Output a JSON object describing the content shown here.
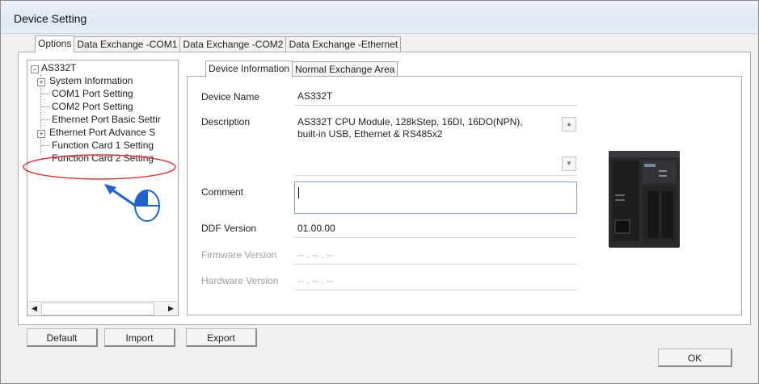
{
  "window": {
    "title": "Device Setting"
  },
  "top_tabs": [
    {
      "label": "Options"
    },
    {
      "label": "Data Exchange -COM1"
    },
    {
      "label": "Data Exchange -COM2"
    },
    {
      "label": "Data Exchange -Ethernet"
    }
  ],
  "tree": {
    "root": "AS332T",
    "items": [
      {
        "label": "System Information"
      },
      {
        "label": "COM1 Port Setting"
      },
      {
        "label": "COM2 Port Setting"
      },
      {
        "label": "Ethernet Port Basic Settir"
      },
      {
        "label": "Ethernet Port Advance S"
      },
      {
        "label": "Function Card 1 Setting"
      },
      {
        "label": "Function Card 2 Setting"
      }
    ]
  },
  "inner_tabs": [
    {
      "label": "Device Information"
    },
    {
      "label": "Normal Exchange Area"
    }
  ],
  "device_info": {
    "device_name_label": "Device Name",
    "device_name_value": "AS332T",
    "description_label": "Description",
    "description_line1": "AS332T CPU Module, 128kStep, 16DI, 16DO(NPN),",
    "description_line2": "built-in USB, Ethernet & RS485x2",
    "comment_label": "Comment",
    "comment_value": "",
    "ddf_version_label": "DDF Version",
    "ddf_version_value": "01.00.00",
    "firmware_version_label": "Firmware Version",
    "firmware_version_value": "-- . -- . --",
    "hardware_version_label": "Hardware Version",
    "hardware_version_value": "-- . -- . --"
  },
  "buttons": {
    "default": "Default",
    "import": "Import",
    "export": "Export",
    "ok": "OK"
  },
  "icons": {
    "tree_expand": "plus-box-icon",
    "tree_collapse": "minus-box-icon",
    "scroll_left": "arrow-left-icon",
    "scroll_right": "arrow-right-icon",
    "mouse": "mouse-icon"
  },
  "colors": {
    "highlight_ellipse": "#e03030",
    "annotation_arrow": "#1f63c8"
  }
}
